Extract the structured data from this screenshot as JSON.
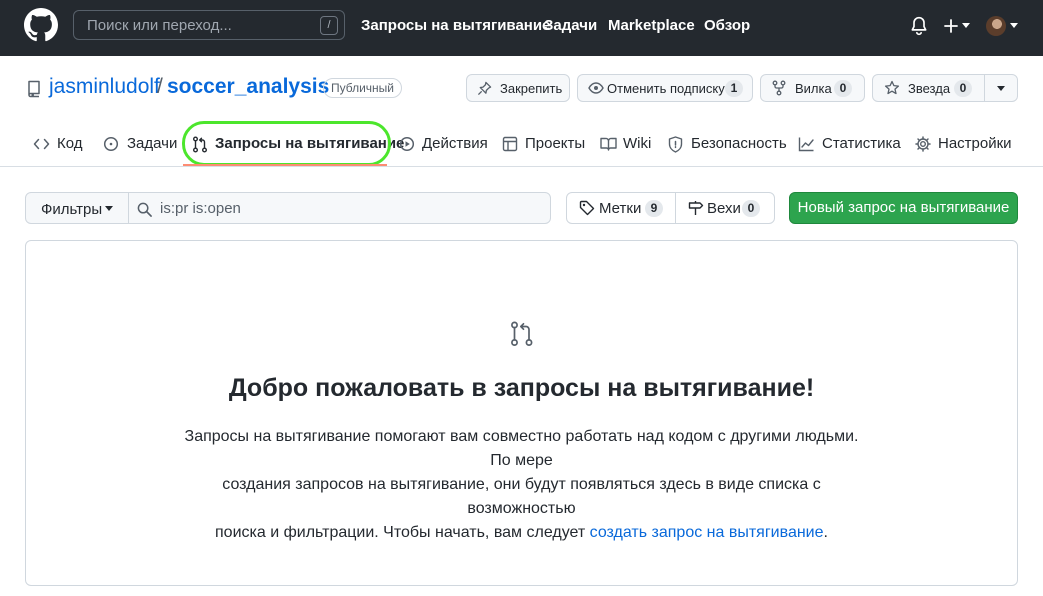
{
  "header": {
    "search_placeholder": "Поиск или переход...",
    "search_shortcut": "/",
    "nav": [
      "Запросы на вытягивание",
      "Задачи",
      "Marketplace",
      "Обзор"
    ]
  },
  "repo": {
    "owner": "jasminludolf",
    "separator": "/",
    "name": "soccer_analysis",
    "visibility": "Публичный",
    "pin_label": "Закрепить",
    "watch_label": "Отменить подписку",
    "watch_count": "1",
    "fork_label": "Вилка",
    "fork_count": "0",
    "star_label": "Звезда",
    "star_count": "0"
  },
  "tabs": [
    {
      "label": "Код",
      "icon": "code-icon"
    },
    {
      "label": "Задачи",
      "icon": "issue-icon"
    },
    {
      "label": "Запросы на вытягивание",
      "icon": "pull-request-icon",
      "active": true
    },
    {
      "label": "Действия",
      "icon": "play-icon"
    },
    {
      "label": "Проекты",
      "icon": "table-icon"
    },
    {
      "label": "Wiki",
      "icon": "book-icon"
    },
    {
      "label": "Безопасность",
      "icon": "shield-icon"
    },
    {
      "label": "Статистика",
      "icon": "graph-icon"
    },
    {
      "label": "Настройки",
      "icon": "gear-icon"
    }
  ],
  "filters": {
    "filter_label": "Фильтры",
    "query": "is:pr is:open",
    "labels_label": "Метки",
    "labels_count": "9",
    "milestones_label": "Вехи",
    "milestones_count": "0",
    "new_pr_label": "Новый запрос на вытягивание"
  },
  "blankslate": {
    "title": "Добро пожаловать в запросы на вытягивание!",
    "text_line1": "Запросы на вытягивание помогают вам совместно работать над кодом с другими людьми. По мере",
    "text_line2": "создания запросов на вытягивание, они будут появляться здесь в виде списка с возможностью",
    "text_line3_prefix": "поиска и фильтрации. Чтобы начать, вам следует ",
    "link": "создать запрос на вытягивание",
    "text_line3_suffix": "."
  },
  "colors": {
    "header_bg": "#24292f",
    "link": "#0969da",
    "primary_button": "#2da44e",
    "highlight": "#4ce62c",
    "active_underline": "#fd8c73"
  }
}
